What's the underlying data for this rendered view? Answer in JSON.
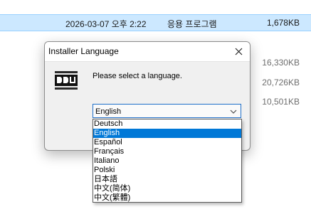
{
  "explorer": {
    "row": {
      "date": "2026-03-07 오후 2:22",
      "type": "응용 프로그램",
      "size": "1,678KB"
    },
    "sizes": [
      "16,330KB",
      "20,726KB",
      "10,501KB"
    ]
  },
  "dialog": {
    "title": "Installer Language",
    "close_icon": "close-icon",
    "logo": "ddu-logo",
    "prompt": "Please select a language.",
    "combo": {
      "selected": "English"
    },
    "options": [
      "Deutsch",
      "English",
      "Español",
      "Français",
      "Italiano",
      "Polski",
      "日本語",
      "中文(简体)",
      "中文(繁體)"
    ],
    "highlighted_index": 1
  },
  "colors": {
    "accent": "#0078d7",
    "row_highlight": "#cce8ff",
    "combo_border": "#1e6fc9"
  }
}
